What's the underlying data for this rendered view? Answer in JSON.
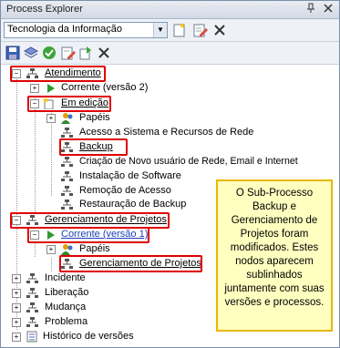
{
  "window": {
    "title": "Process Explorer",
    "pin_glyph": "→",
    "close_glyph": "✕"
  },
  "toolbar": {
    "process_selector": "Tecnologia da Informação"
  },
  "tree": {
    "atendimento": "Atendimento",
    "corrente_v2": "Corrente (versão 2)",
    "em_edicao": "Em edição",
    "papeis1": "Papéis",
    "acesso": "Acesso a Sistema e Recursos de Rede",
    "backup": "Backup",
    "criacao": "Criação de Novo usuário de Rede, Email e Internet",
    "instalacao": "Instalação de Software",
    "remocao": "Remoção de Acesso",
    "restauracao": "Restauração de Backup",
    "gerenciamento": "Gerenciamento de Projetos",
    "corrente_v1": "Corrente (versão 1)",
    "papeis2": "Papéis",
    "gerenciamento_sub": "Gerenciamento de Projetos",
    "incidente": "Incidente",
    "liberacao": "Liberação",
    "mudanca": "Mudança",
    "problema": "Problema",
    "historico": "Histórico de versões"
  },
  "note": "O Sub-Processo Backup e Gerenciamento de Projetos foram modificados. Estes nodos aparecem sublinhados juntamente com suas versões e processos.",
  "colors": {
    "highlight": "#e00000",
    "note_bg": "#ffffc0",
    "note_border": "#e8b800"
  }
}
